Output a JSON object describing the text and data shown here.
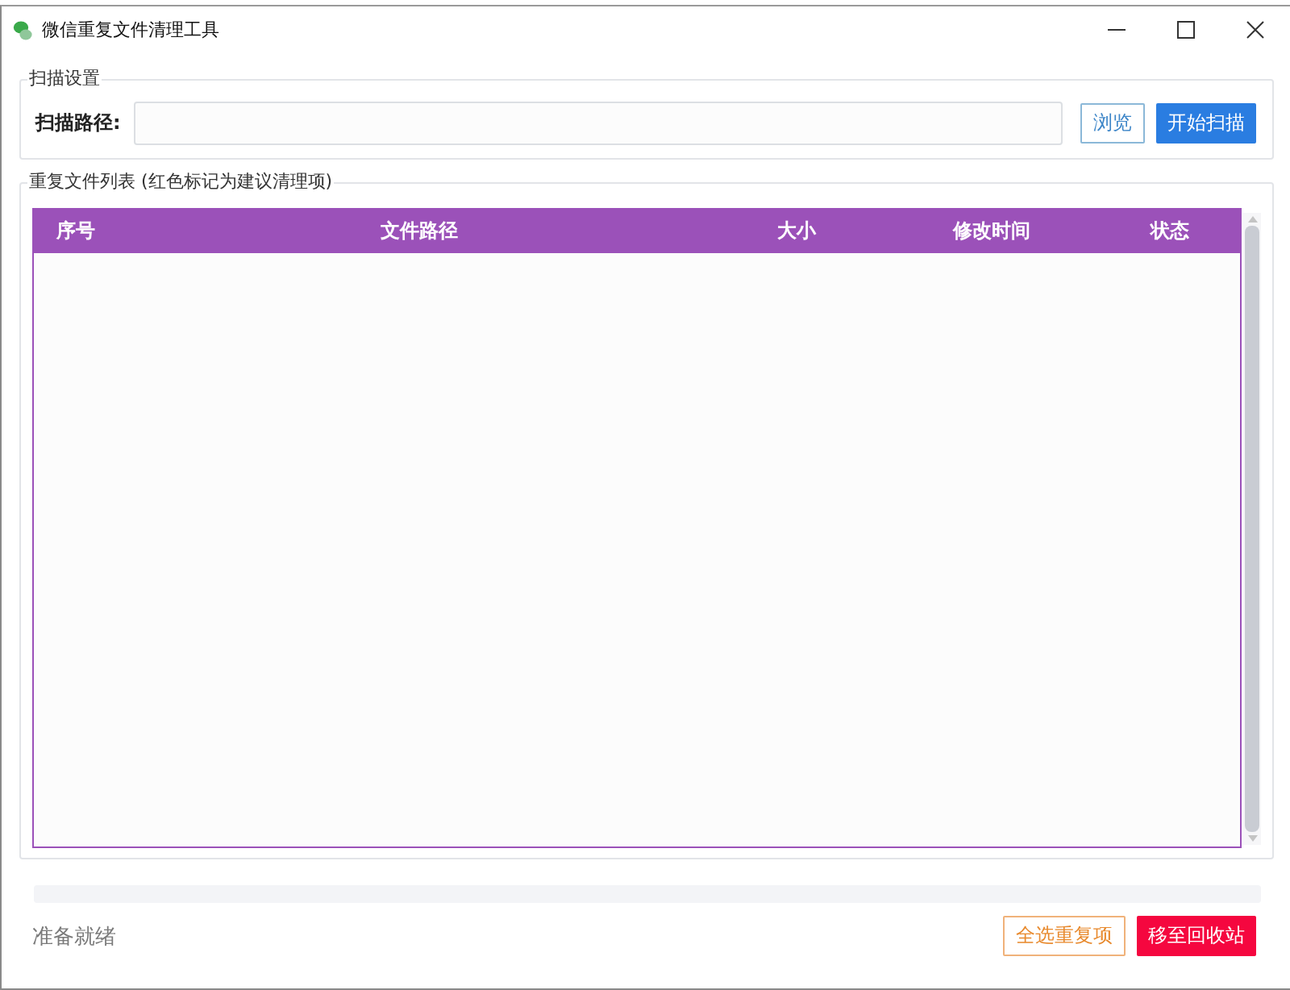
{
  "window": {
    "title": "微信重复文件清理工具"
  },
  "scan_settings": {
    "legend": "扫描设置",
    "path_label": "扫描路径:",
    "buttons": [
      {
        "label": "浏览",
        "kind": "outline"
      },
      {
        "label": "开始扫描",
        "kind": "primary"
      }
    ]
  },
  "file_list": {
    "legend": "重复文件列表 (红色标记为建议清理项)",
    "table": {
      "columns": [
        "序号",
        "文件路径",
        "大小",
        "修改时间",
        "状态"
      ]
    }
  },
  "progress": {
    "level": 0
  },
  "status_bar": {
    "text": "准备就绪",
    "buttons": [
      {
        "label": "全选重复项",
        "kind": "warning-outline"
      },
      {
        "label": "移至回收站",
        "kind": "danger"
      }
    ]
  }
}
